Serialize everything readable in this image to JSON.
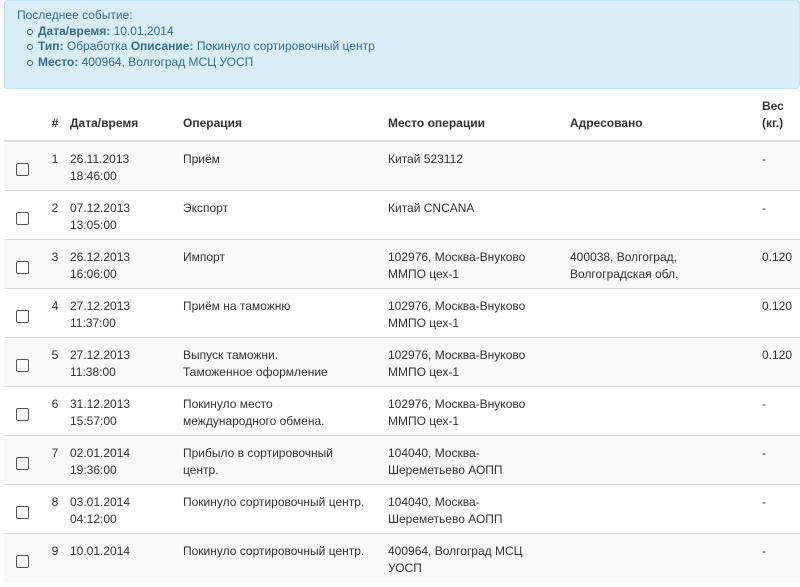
{
  "last_event": {
    "heading": "Последнее событие",
    "datetime_label": "Дата/время:",
    "datetime_value": "10.01.2014",
    "type_label": "Тип:",
    "type_value": "Обработка",
    "desc_label": "Описание:",
    "desc_value": "Покинуло сортировочный центр",
    "place_label": "Место:",
    "place_value": "400964, Волгоград МСЦ УОСП"
  },
  "table": {
    "headers": {
      "num": "#",
      "datetime": "Дата/время",
      "operation": "Операция",
      "place": "Место операции",
      "addressed": "Адресовано",
      "weight_line1": "Вес",
      "weight_line2": "(кг.)"
    },
    "rows": [
      {
        "n": "1",
        "date": "26.11.2013",
        "time": "18:46:00",
        "op1": "Приём",
        "op2": "",
        "place1": "Китай 523112",
        "place2": "",
        "addr1": "",
        "addr2": "",
        "weight": "-"
      },
      {
        "n": "2",
        "date": "07.12.2013",
        "time": "13:05:00",
        "op1": "Экспорт",
        "op2": "",
        "place1": "Китай CNCANA",
        "place2": "",
        "addr1": "",
        "addr2": "",
        "weight": "-"
      },
      {
        "n": "3",
        "date": "26.12.2013",
        "time": "16:06:00",
        "op1": "Импорт",
        "op2": "",
        "place1": "102976, Москва-Внуково",
        "place2": "ММПО цех-1",
        "addr1": "400038, Волгоград,",
        "addr2": "Волгоградская обл.",
        "weight": "0.120"
      },
      {
        "n": "4",
        "date": "27.12.2013",
        "time": "11:37:00",
        "op1": "Приём на таможню",
        "op2": "",
        "place1": "102976, Москва-Внуково",
        "place2": "ММПО цех-1",
        "addr1": "",
        "addr2": "",
        "weight": "0.120"
      },
      {
        "n": "5",
        "date": "27.12.2013",
        "time": "11:38:00",
        "op1": "Выпуск таможни.",
        "op2": "Таможенное оформление",
        "place1": "102976, Москва-Внуково",
        "place2": "ММПО цех-1",
        "addr1": "",
        "addr2": "",
        "weight": "0.120"
      },
      {
        "n": "6",
        "date": "31.12.2013",
        "time": "15:57:00",
        "op1": "Покинуло место",
        "op2": "международного обмена.",
        "place1": "102976, Москва-Внуково",
        "place2": "ММПО цех-1",
        "addr1": "",
        "addr2": "",
        "weight": "-"
      },
      {
        "n": "7",
        "date": "02.01.2014",
        "time": "19:36:00",
        "op1": "Прибыло в сортировочный",
        "op2": "центр.",
        "place1": "104040, Москва-",
        "place2": "Шереметьево АОПП",
        "addr1": "",
        "addr2": "",
        "weight": "-"
      },
      {
        "n": "8",
        "date": "03.01.2014",
        "time": "04:12:00",
        "op1": "Покинуло сортировочный центр.",
        "op2": "",
        "place1": "104040, Москва-",
        "place2": "Шереметьево АОПП",
        "addr1": "",
        "addr2": "",
        "weight": "-"
      },
      {
        "n": "9",
        "date": "10.01.2014",
        "time": "",
        "op1": "Покинуло сортировочный центр.",
        "op2": "",
        "place1": "400964, Волгоград МСЦ",
        "place2": "УОСП",
        "addr1": "",
        "addr2": "",
        "weight": "-"
      }
    ]
  }
}
